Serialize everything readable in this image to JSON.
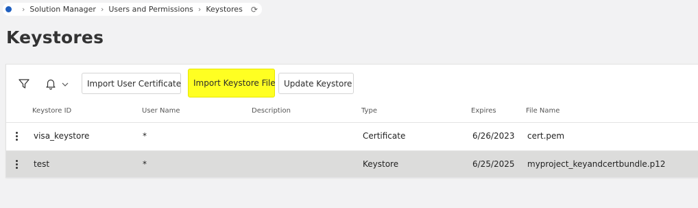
{
  "breadcrumb": {
    "items": [
      "Solution Manager",
      "Users and Permissions",
      "Keystores"
    ]
  },
  "page": {
    "title": "Keystores"
  },
  "toolbar": {
    "import_user_certificate": "Import User Certificate",
    "import_keystore_file": "Import Keystore File",
    "update_keystore": "Update Keystore"
  },
  "table": {
    "columns": [
      "Keystore ID",
      "User Name",
      "Description",
      "Type",
      "Expires",
      "File Name"
    ],
    "rows": [
      {
        "keystore_id": "visa_keystore",
        "user_name": "*",
        "description": "",
        "type": "Certificate",
        "expires": "6/26/2023",
        "file_name": "cert.pem"
      },
      {
        "keystore_id": "test",
        "user_name": "*",
        "description": "",
        "type": "Keystore",
        "expires": "6/25/2025",
        "file_name": "myproject_keyandcertbundle.p12"
      }
    ]
  },
  "colors": {
    "highlight": "#ffff22",
    "selected_row": "#dcdcdb",
    "breadcrumb_dot": "#1f5fbf"
  }
}
